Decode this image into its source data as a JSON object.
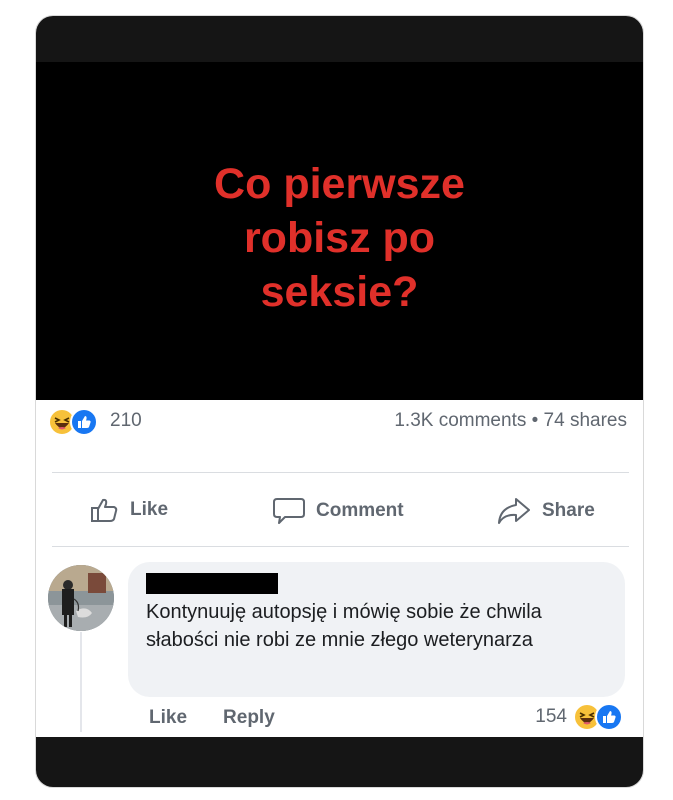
{
  "post": {
    "image_text_lines": [
      "Co pierwsze",
      "robisz po",
      "seksie?"
    ],
    "colors": {
      "image_text": "#e0302a",
      "accent": "#1877f2"
    }
  },
  "stats": {
    "reaction_count": "210",
    "comments_shares": "1.3K comments • 74 shares",
    "reaction_icons": [
      "haha-emoji-icon",
      "like-icon"
    ]
  },
  "actions": {
    "like_label": "Like",
    "comment_label": "Comment",
    "share_label": "Share"
  },
  "comment": {
    "text": "Kontynuuję autopsję i mówię sobie że chwila słabości nie robi ze mnie złego weterynarza",
    "like_label": "Like",
    "reply_label": "Reply",
    "reaction_count": "154",
    "reaction_icons": [
      "haha-emoji-icon",
      "like-icon"
    ]
  }
}
